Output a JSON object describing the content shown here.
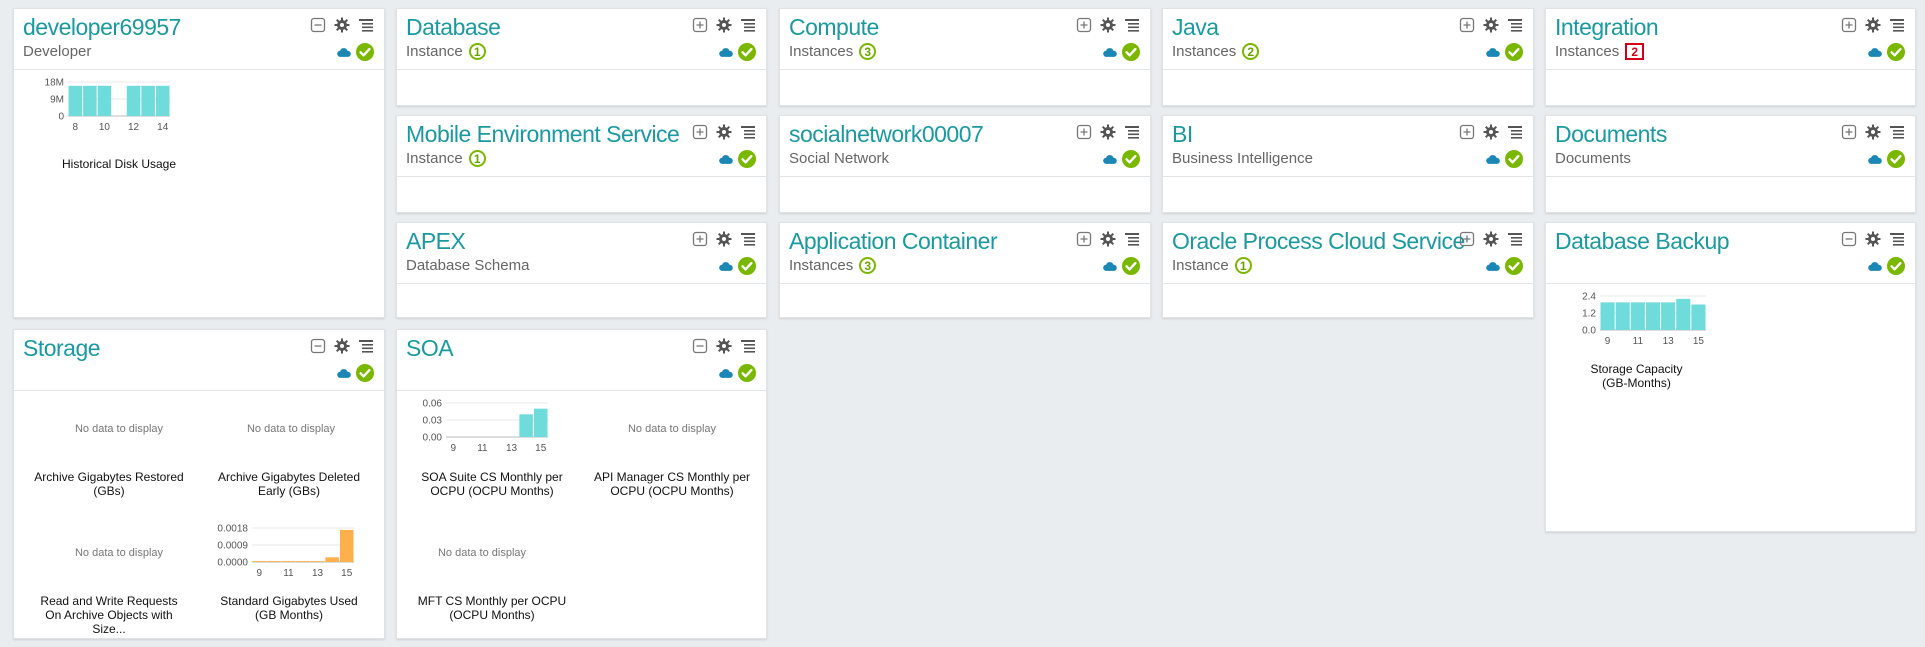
{
  "cards": {
    "developer": {
      "title": "developer69957",
      "subtitle": "Developer"
    },
    "database": {
      "title": "Database",
      "label": "Instance",
      "count": "1"
    },
    "compute": {
      "title": "Compute",
      "label": "Instances",
      "count": "3"
    },
    "java": {
      "title": "Java",
      "label": "Instances",
      "count": "2"
    },
    "integration": {
      "title": "Integration",
      "label": "Instances",
      "count": "2"
    },
    "mobile": {
      "title": "Mobile Environment Service",
      "label": "Instance",
      "count": "1"
    },
    "social": {
      "title": "socialnetwork00007",
      "subtitle": "Social Network"
    },
    "bi": {
      "title": "BI",
      "subtitle": "Business Intelligence"
    },
    "documents": {
      "title": "Documents",
      "subtitle": "Documents"
    },
    "apex": {
      "title": "APEX",
      "subtitle": "Database Schema"
    },
    "appcontainer": {
      "title": "Application Container",
      "label": "Instances",
      "count": "3"
    },
    "opcs": {
      "title": "Oracle Process Cloud Service",
      "label": "Instance",
      "count": "1"
    },
    "dbbackup": {
      "title": "Database Backup"
    },
    "storage": {
      "title": "Storage"
    },
    "soa": {
      "title": "SOA"
    }
  },
  "no_data_text": "No data to display",
  "colors": {
    "bar": "#6fdbdb",
    "bar_orange": "#fdb04b",
    "title": "#1a9aa0",
    "ok": "#7ab800",
    "warn": "#d4001a",
    "cloud": "#1a87b5"
  },
  "chart_data": [
    {
      "id": "disk",
      "type": "bar",
      "title": "Historical Disk Usage",
      "x": [
        8,
        9,
        10,
        11,
        12,
        13,
        14
      ],
      "values": [
        16,
        16,
        16,
        0,
        16,
        16,
        16
      ],
      "yticks": [
        "18M",
        "9M",
        "0"
      ],
      "ylim": [
        0,
        18
      ],
      "xticks": [
        "8",
        "10",
        "12",
        "14"
      ],
      "unit": "M"
    },
    {
      "id": "backup",
      "type": "bar",
      "title": "Storage Capacity (GB-Months)",
      "x": [
        9,
        10,
        11,
        12,
        13,
        14,
        15
      ],
      "values": [
        1.95,
        1.95,
        1.95,
        1.95,
        1.95,
        2.2,
        1.8
      ],
      "yticks": [
        "2.4",
        "1.2",
        "0.0"
      ],
      "ylim": [
        0,
        2.4
      ],
      "xticks": [
        "9",
        "11",
        "13",
        "15"
      ]
    },
    {
      "id": "soasuite",
      "type": "bar",
      "title": "SOA Suite CS Monthly per OCPU (OCPU Months)",
      "x": [
        9,
        10,
        11,
        12,
        13,
        14,
        15
      ],
      "values": [
        0,
        0,
        0,
        0,
        0,
        0.04,
        0.05
      ],
      "yticks": [
        "0.06",
        "0.03",
        "0.00"
      ],
      "ylim": [
        0,
        0.06
      ],
      "xticks": [
        "9",
        "11",
        "13",
        "15"
      ]
    },
    {
      "id": "stdgb",
      "type": "bar",
      "title": "Standard Gigabytes Used (GB Months)",
      "x": [
        9,
        10,
        11,
        12,
        13,
        14,
        15
      ],
      "values": [
        5e-05,
        5e-05,
        5e-05,
        5e-05,
        5e-05,
        0.00025,
        0.0017
      ],
      "yticks": [
        "0.0018",
        "0.0009",
        "0.0000"
      ],
      "ylim": [
        0,
        0.0018
      ],
      "xticks": [
        "9",
        "11",
        "13",
        "15"
      ]
    }
  ],
  "captions": {
    "archive_restored": "Archive Gigabytes Restored (GBs)",
    "archive_deleted": "Archive Gigabytes Deleted Early (GBs)",
    "rw_requests": "Read and Write Requests On Archive Objects with Size...",
    "api_manager": "API Manager CS Monthly per OCPU (OCPU Months)",
    "mft": "MFT CS Monthly per OCPU (OCPU Months)"
  }
}
